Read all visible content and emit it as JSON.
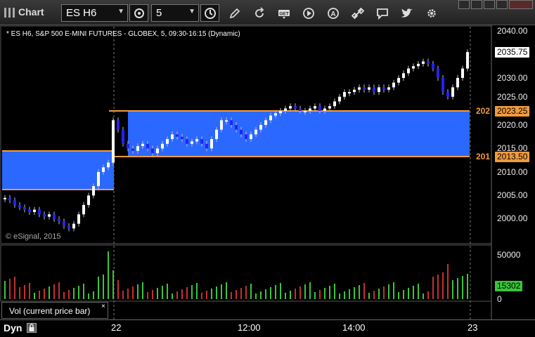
{
  "toolbar": {
    "title": "Chart",
    "symbol": "ES H6",
    "interval": "5",
    "icons": [
      "cycle-icon",
      "clock-icon",
      "pencil-icon",
      "refresh-icon",
      "get-icon",
      "play-icon",
      "a-icon",
      "link-icon",
      "comment-icon",
      "twitter-icon",
      "gear-icon"
    ]
  },
  "chart": {
    "info": "* ES H6, S&P 500 E-MINI FUTURES - GLOBEX, 5, 09:30-16:15 (Dynamic)",
    "copyright": "© eSignal, 2015",
    "last_price": "2035.75",
    "upper_level": "2023.25",
    "upper_level_trunc": "202",
    "lower_level": "2013.50",
    "lower_level_trunc": "201",
    "price_axis": [
      "2040.00",
      "2035.00",
      "2030.00",
      "2025.00",
      "2020.00",
      "2015.00",
      "2010.00",
      "2005.00",
      "2000.00"
    ],
    "colors": {
      "up": "#ffffff",
      "down": "#2222ff",
      "zone": "#2a68ff",
      "level": "#f29a3e",
      "vol_up": "#3ac53a",
      "vol_down": "#c53030"
    }
  },
  "volume": {
    "label": "Vol (current price bar)",
    "close": "×",
    "axis": [
      "50000",
      "0"
    ],
    "current": "15302"
  },
  "time_axis": {
    "mode": "Dyn",
    "labels": [
      "22",
      "12:00",
      "14:00",
      "23"
    ]
  }
}
